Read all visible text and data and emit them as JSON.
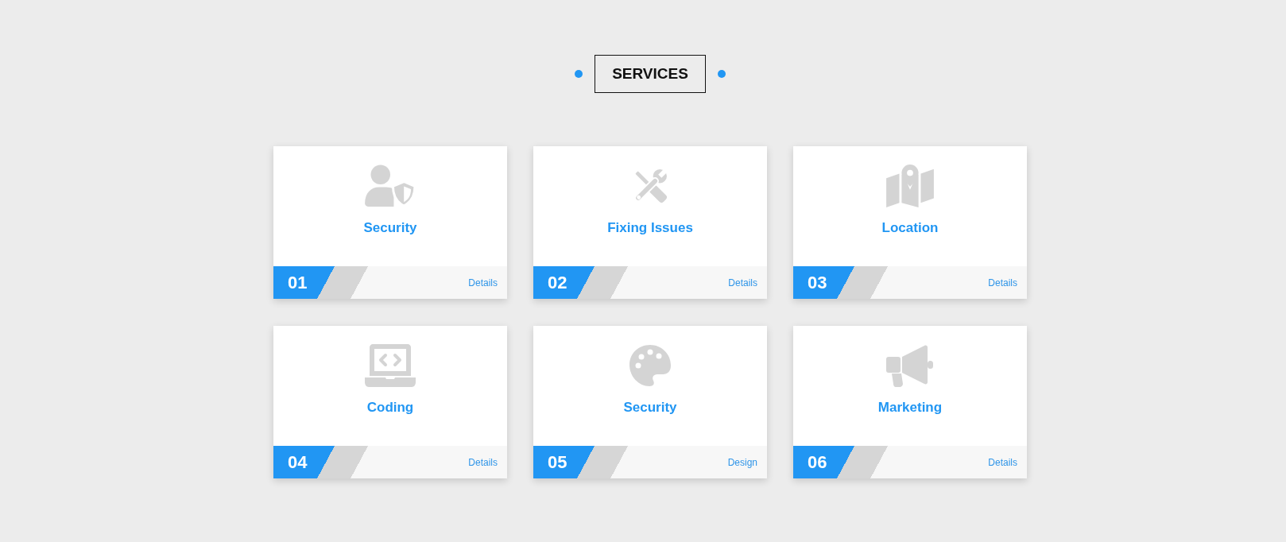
{
  "section": {
    "title": "SERVICES"
  },
  "services": [
    {
      "kind": "user",
      "title": "Security",
      "number": "01",
      "link": "Details"
    },
    {
      "kind": "tools",
      "title": "Fixing Issues",
      "number": "02",
      "link": "Details"
    },
    {
      "kind": "map",
      "title": "Location",
      "number": "03",
      "link": "Details"
    },
    {
      "kind": "laptop",
      "title": "Coding",
      "number": "04",
      "link": "Details"
    },
    {
      "kind": "palette",
      "title": "Security",
      "number": "05",
      "link": "Design"
    },
    {
      "kind": "megaphone",
      "title": "Marketing",
      "number": "06",
      "link": "Details"
    }
  ]
}
